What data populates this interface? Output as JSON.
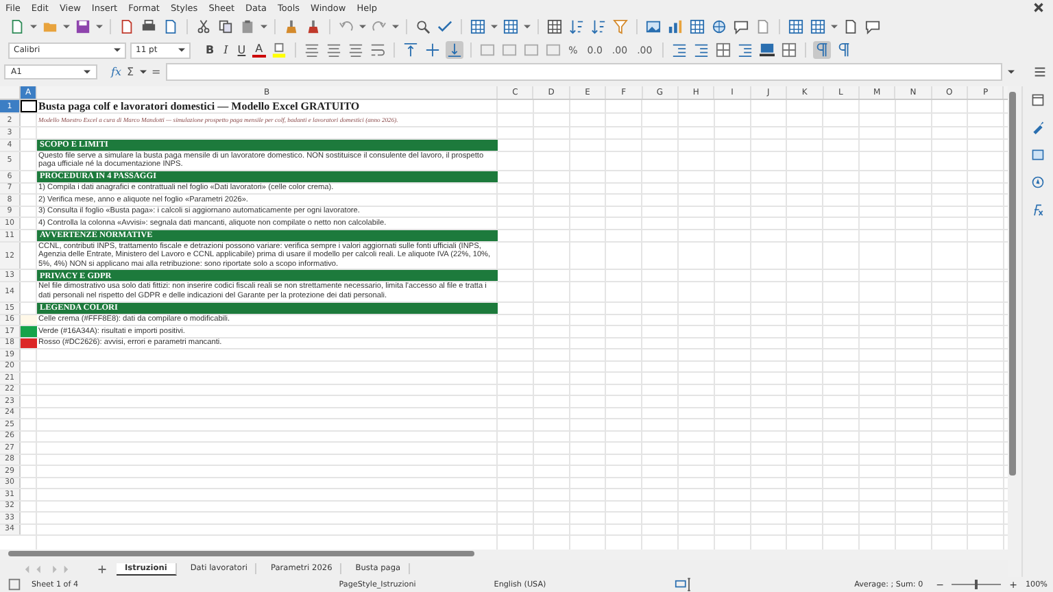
{
  "menu": [
    "File",
    "Edit",
    "View",
    "Insert",
    "Format",
    "Styles",
    "Sheet",
    "Data",
    "Tools",
    "Window",
    "Help"
  ],
  "font_name": {
    "value": "Calibri"
  },
  "font_size": {
    "value": "11 pt"
  },
  "text_format": [
    {
      "label": "B",
      "kind": "bold"
    },
    {
      "label": "I",
      "kind": "italic"
    },
    {
      "label": "U",
      "kind": "underline"
    }
  ],
  "font_color_label": "A",
  "vertical_align": [
    {
      "selected": false
    },
    {
      "selected": false
    },
    {
      "selected": true
    }
  ],
  "number_formats": [
    "%",
    "0.0",
    ".00",
    ".00"
  ],
  "text_direction": [
    {
      "selected": true
    },
    {
      "selected": false
    }
  ],
  "name_box": {
    "value": "A1"
  },
  "formula_bar": {
    "function_label": "fx",
    "sum_label": "Σ",
    "equals_label": "="
  },
  "columns": [
    {
      "label": "A",
      "selected": true
    },
    {
      "label": "B",
      "selected": false
    },
    {
      "label": "C",
      "selected": false
    },
    {
      "label": "D",
      "selected": false
    },
    {
      "label": "E",
      "selected": false
    },
    {
      "label": "F",
      "selected": false
    },
    {
      "label": "G",
      "selected": false
    },
    {
      "label": "H",
      "selected": false
    },
    {
      "label": "I",
      "selected": false
    },
    {
      "label": "J",
      "selected": false
    },
    {
      "label": "K",
      "selected": false
    },
    {
      "label": "L",
      "selected": false
    },
    {
      "label": "M",
      "selected": false
    },
    {
      "label": "N",
      "selected": false
    },
    {
      "label": "O",
      "selected": false
    },
    {
      "label": "P",
      "selected": false
    }
  ],
  "rows": [
    {
      "number": "1",
      "selected": true,
      "kind": "title",
      "text": "Busta paga colf e lavoratori domestici — Modello Excel GRATUITO"
    },
    {
      "number": "2",
      "selected": false,
      "kind": "subtitle",
      "text": "Modello Maestro Excel a cura di Marco Mandotti — simulazione prospetto paga mensile per colf, badanti e lavoratori domestici (anno 2026)."
    },
    {
      "number": "3",
      "selected": false,
      "kind": "empty"
    },
    {
      "number": "4",
      "selected": false,
      "kind": "section",
      "text": "SCOPO E LIMITI"
    },
    {
      "number": "5",
      "selected": false,
      "kind": "text",
      "text": "Questo file serve a simulare la busta paga mensile di un lavoratore domestico. NON sostituisce il consulente del lavoro, il prospetto paga ufficiale né la documentazione INPS."
    },
    {
      "number": "6",
      "selected": false,
      "kind": "section",
      "text": "PROCEDURA IN 4 PASSAGGI"
    },
    {
      "number": "7",
      "selected": false,
      "kind": "text",
      "text": "1) Compila i dati anagrafici e contrattuali nel foglio «Dati lavoratori» (celle color crema)."
    },
    {
      "number": "8",
      "selected": false,
      "kind": "text",
      "text": "2) Verifica mese, anno e aliquote nel foglio «Parametri 2026»."
    },
    {
      "number": "9",
      "selected": false,
      "kind": "text",
      "text": "3) Consulta il foglio «Busta paga»: i calcoli si aggiornano automaticamente per ogni lavoratore."
    },
    {
      "number": "10",
      "selected": false,
      "kind": "text",
      "text": "4) Controlla la colonna «Avvisi»: segnala dati mancanti, aliquote non compilate o netto non calcolabile."
    },
    {
      "number": "11",
      "selected": false,
      "kind": "section",
      "text": "AVVERTENZE NORMATIVE"
    },
    {
      "number": "12",
      "selected": false,
      "kind": "text",
      "text": "CCNL, contributi INPS, trattamento fiscale e detrazioni possono variare: verifica sempre i valori aggiornati sulle fonti ufficiali (INPS, Agenzia delle Entrate, Ministero del Lavoro e CCNL applicabile) prima di usare il modello per calcoli reali. Le aliquote IVA (22%, 10%, 5%, 4%) NON si applicano mai alla retribuzione: sono riportate solo a scopo informativo."
    },
    {
      "number": "13",
      "selected": false,
      "kind": "section",
      "text": "PRIVACY E GDPR"
    },
    {
      "number": "14",
      "selected": false,
      "kind": "text",
      "text": "Nel file dimostrativo usa solo dati fittizi: non inserire codici fiscali reali se non strettamente necessario, limita l'accesso al file e tratta i dati personali nel rispetto del GDPR e delle indicazioni del Garante per la protezione dei dati personali."
    },
    {
      "number": "15",
      "selected": false,
      "kind": "section",
      "text": "LEGENDA COLORI"
    },
    {
      "number": "16",
      "selected": false,
      "kind": "legend",
      "color": "#fff8e8",
      "text": "Celle crema (#FFF8E8): dati da compilare o modificabili."
    },
    {
      "number": "17",
      "selected": false,
      "kind": "legend",
      "color": "#16a34a",
      "text": "Verde (#16A34A): risultati e importi positivi."
    },
    {
      "number": "18",
      "selected": false,
      "kind": "legend",
      "color": "#dc2626",
      "text": "Rosso (#DC2626): avvisi, errori e parametri mancanti."
    },
    {
      "number": "19",
      "selected": false,
      "kind": "empty"
    },
    {
      "number": "20",
      "selected": false,
      "kind": "empty"
    },
    {
      "number": "21",
      "selected": false,
      "kind": "empty"
    },
    {
      "number": "22",
      "selected": false,
      "kind": "empty"
    },
    {
      "number": "23",
      "selected": false,
      "kind": "empty"
    },
    {
      "number": "24",
      "selected": false,
      "kind": "empty"
    },
    {
      "number": "25",
      "selected": false,
      "kind": "empty"
    },
    {
      "number": "26",
      "selected": false,
      "kind": "empty"
    },
    {
      "number": "27",
      "selected": false,
      "kind": "empty"
    },
    {
      "number": "28",
      "selected": false,
      "kind": "empty"
    },
    {
      "number": "29",
      "selected": false,
      "kind": "empty"
    },
    {
      "number": "30",
      "selected": false,
      "kind": "empty"
    },
    {
      "number": "31",
      "selected": false,
      "kind": "empty"
    },
    {
      "number": "32",
      "selected": false,
      "kind": "empty"
    },
    {
      "number": "33",
      "selected": false,
      "kind": "empty"
    },
    {
      "number": "34",
      "selected": false,
      "kind": "empty"
    }
  ],
  "sheet_tabs": [
    {
      "label": "Istruzioni",
      "selected": true
    },
    {
      "label": "Dati lavoratori",
      "selected": false
    },
    {
      "label": "Parametri 2026",
      "selected": false
    },
    {
      "label": "Busta paga",
      "selected": false
    }
  ],
  "status_bar": {
    "sheet": "Sheet 1 of 4",
    "page_style": "PageStyle_Istruzioni",
    "language": "English (USA)",
    "summary": "Average: ; Sum: 0",
    "zoom_out_label": "−",
    "zoom_in_label": "+",
    "zoom_slider": {
      "level": 0.5
    },
    "zoom": "100%"
  }
}
